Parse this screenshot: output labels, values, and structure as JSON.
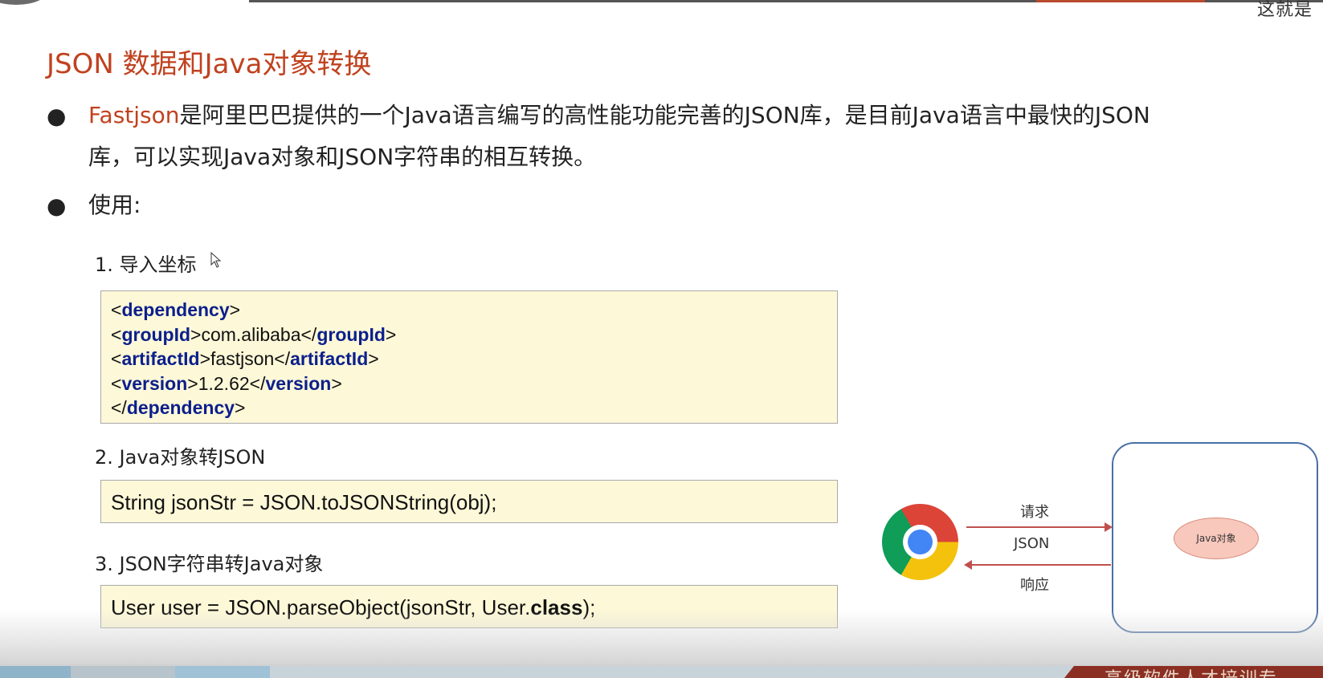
{
  "corner_text": "这就是",
  "title": "JSON 数据和Java对象转换",
  "bullets": {
    "b1_highlight": "Fastjson",
    "b1_line1_rest": "是阿里巴巴提供的一个Java语言编写的高性能功能完善的JSON库，是目前Java语言中最快的JSON",
    "b1_line2": "库，可以实现Java对象和JSON字符串的相互转换。",
    "b2": "使用:"
  },
  "steps": {
    "s1": "1. 导入坐标",
    "s2": "2. Java对象转JSON",
    "s3": "3. JSON字符串转Java对象"
  },
  "xml": {
    "open_lt": "<",
    "gt": ">",
    "close_lt": "</",
    "dependency": "dependency",
    "groupId": "groupId",
    "groupId_val": "com.alibaba",
    "artifactId": "artifactId",
    "artifactId_val": "fastjson",
    "version": "version",
    "version_val": "1.2.62"
  },
  "code": {
    "line2": "String jsonStr = JSON.toJSONString(obj);",
    "line3_pre": "User user = JSON.parseObject(jsonStr, User.",
    "line3_kw": "class",
    "line3_post": ");"
  },
  "diagram": {
    "request": "请求",
    "json": "JSON",
    "response": "响应",
    "java_object": "Java对象"
  },
  "bottom_text": "高级软件人才培训专"
}
